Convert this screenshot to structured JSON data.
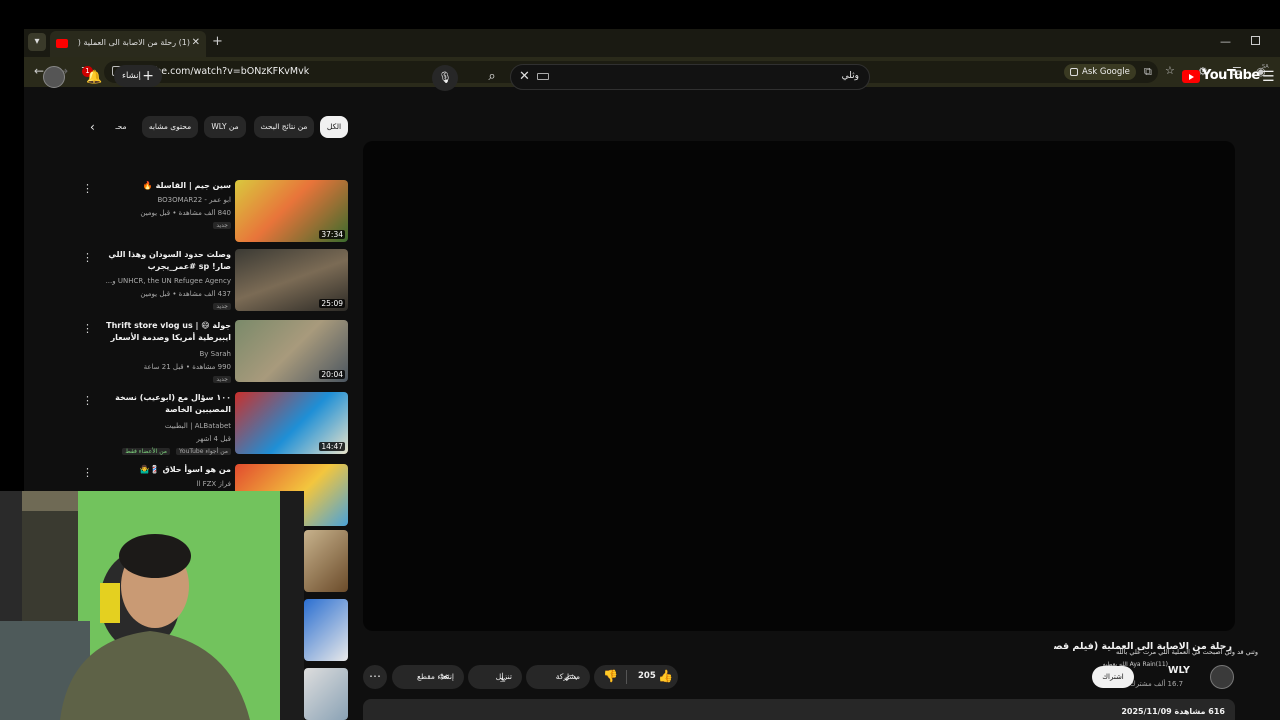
{
  "browser": {
    "tab_title": "(1) رحلة من الاصابة الى العملية (",
    "tab_badge": "1",
    "url": "youtube.com/watch?v=bONzKFKvMvk",
    "ask_google": "Ask Google",
    "icons": [
      "tab-list-icon",
      "youtube-favicon",
      "close-icon",
      "plus-icon",
      "minimize-icon",
      "maximize-icon",
      "back-icon",
      "forward-icon",
      "reload-icon",
      "site-info-icon",
      "lens-icon",
      "install-icon",
      "star-icon",
      "extensions-icon",
      "reading-list-icon",
      "profile-icon"
    ]
  },
  "header": {
    "create_label": "إنشاء",
    "notifications_count": "1",
    "search_value": "وثلي",
    "logo_text": "YouTube",
    "logo_country": "SA"
  },
  "chips": [
    {
      "label": "الكل",
      "active": true
    },
    {
      "label": "من نتائج البحث",
      "active": false
    },
    {
      "label": "من WLY",
      "active": false
    },
    {
      "label": "محتوى مشابه",
      "active": false
    },
    {
      "label": "محـ",
      "active": false
    }
  ],
  "recommendations": [
    {
      "title": "سين جيم | القاسلة 🔥",
      "channel": "ابو عمر - BO3OMAR22",
      "meta": "840 ألف مشاهدة • قبل يومين",
      "badge": "جديد",
      "duration": "37:34"
    },
    {
      "title": "وصلت حدود السودان وهذا اللي صار! sp #عمر_يجرب",
      "channel": "UNHCR, the UN Refugee Agency و...",
      "meta": "437 ألف مشاهدة • قبل يومين",
      "badge": "جديد",
      "duration": "25:09"
    },
    {
      "title": "جولة 😄 | Thrift store vlog us ايبيرطية أمريكا وصدمة الأسعار",
      "channel": "By Sarah",
      "meta": "990 مشاهدة • قبل 21 ساعة",
      "badge": "جديد",
      "duration": "20:04"
    },
    {
      "title": "١٠٠ سؤال مع (ابوعيب) نسخة المصيبين الخاصة",
      "channel": "ALBatabet | البطبيت",
      "meta": "قبل 4 أشهر",
      "badge": "من الأعضاء فقط",
      "badge2": "من أجواء YouTube",
      "duration": "14:47"
    },
    {
      "title": "من هو اسوأ حلاق 💈🤷‍♂️",
      "channel": "فراز ll FZX",
      "meta": "",
      "badge": "",
      "duration": ""
    }
  ],
  "video": {
    "title": "رحلة من الاصابة الى العملية (فيلم قصير)",
    "overlay_text": "وثني قد ولي اصبحت في العملية اللي مرت علي بالله",
    "channel_name": "WLY",
    "channel_subs": "16.7 ألف مشترك",
    "channel_hint": "Aya Rain(11) الله يعطيه",
    "subscribe_label": "اشتراك",
    "likes": "205",
    "share_label": "مشاركة",
    "download_label": "تنزيل",
    "clip_label": "إنشاء مقطع",
    "views_date": "616 مشاهدة 2025/11/09"
  }
}
